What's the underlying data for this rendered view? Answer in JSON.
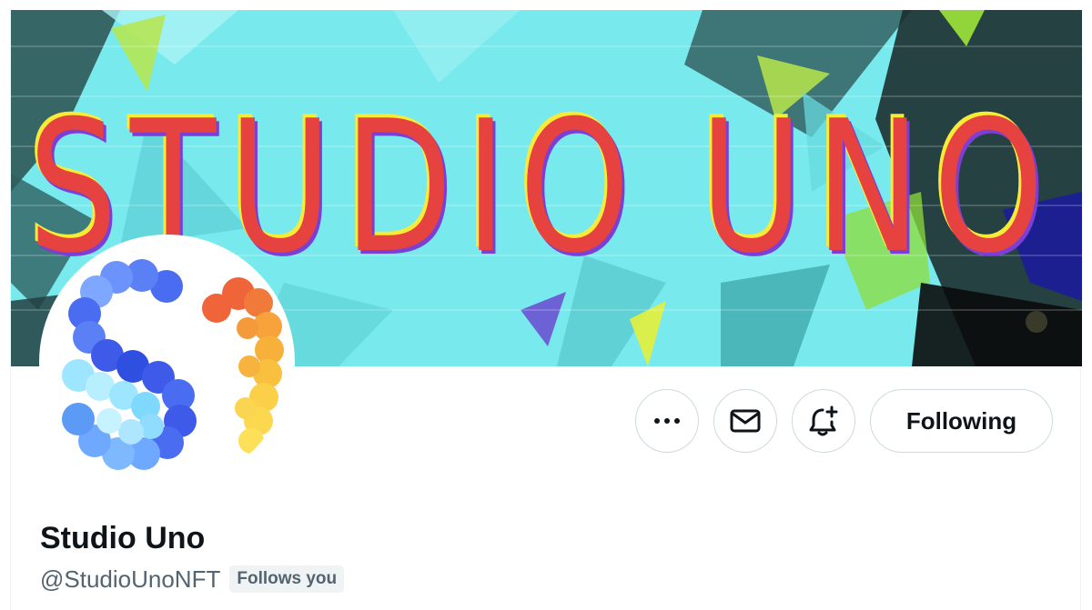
{
  "profile": {
    "banner": {
      "text": "STUDIO UNO",
      "description_colors": [
        "#78eaee",
        "#2b4f4f",
        "#0b0b0b",
        "#e6423f",
        "#7b3fd6",
        "#f6ec38",
        "#9ee53a"
      ]
    },
    "avatar": {
      "mark": "S1",
      "colors": [
        "#4a6cf0",
        "#6fa8ff",
        "#9ee6ff",
        "#f0643a",
        "#f7a23a",
        "#fce05a"
      ]
    },
    "actions": {
      "more_icon": "more-horizontal-icon",
      "message_icon": "envelope-icon",
      "notify_icon": "bell-plus-icon",
      "following_label": "Following"
    },
    "display_name": "Studio Uno",
    "handle": "@StudioUnoNFT",
    "follows_you_label": "Follows you"
  },
  "colors": {
    "text_primary": "#0f1419",
    "text_secondary": "#536471",
    "border": "#cfd9de",
    "badge_bg": "#eff3f4"
  }
}
